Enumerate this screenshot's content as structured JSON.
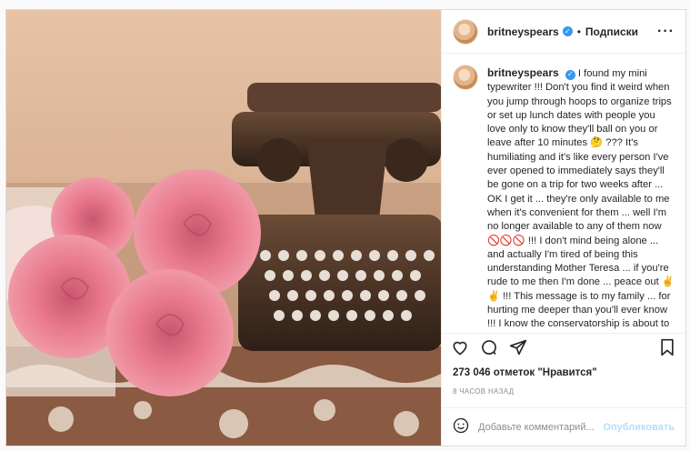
{
  "post": {
    "username": "britneyspears",
    "follow_label": "Подписки",
    "separator": "•",
    "more_label": "···",
    "caption": "I found my mini typewriter !!! Don't you find it weird when you jump through hoops to organize trips or set up lunch dates with people you love only to know they'll ball on you or leave after 10 minutes 🤔 ??? It's humiliating and it's like every person I've ever opened to immediately says they'll be gone on a trip for two weeks after ... OK I get it ... they're only available to me when it's convenient for them ... well I'm no longer available to any of them now 🚫🚫🚫 !!! I don't mind being alone ... and actually I'm tired of being this understanding Mother Teresa ... if you're rude to me then I'm done ... peace out ✌️✌️ !!! This message is to my family ... for hurting me deeper than you'll ever know !!! I know the conservatorship is about to be over but I",
    "likes": "273 046 отметок \"Нравится\"",
    "time": "8 ЧАСОВ НАЗАД",
    "comment_placeholder": "Добавьте комментарий...",
    "publish_label": "Опубликовать"
  },
  "icons": {
    "like": "heart-icon",
    "comment": "comment-icon",
    "share": "share-icon",
    "save": "bookmark-icon",
    "emoji": "emoji-icon",
    "verified": "verified-badge-icon"
  },
  "colors": {
    "verified": "#3897f0",
    "publish": "#b2dffc",
    "muted": "#8e8e8e"
  }
}
